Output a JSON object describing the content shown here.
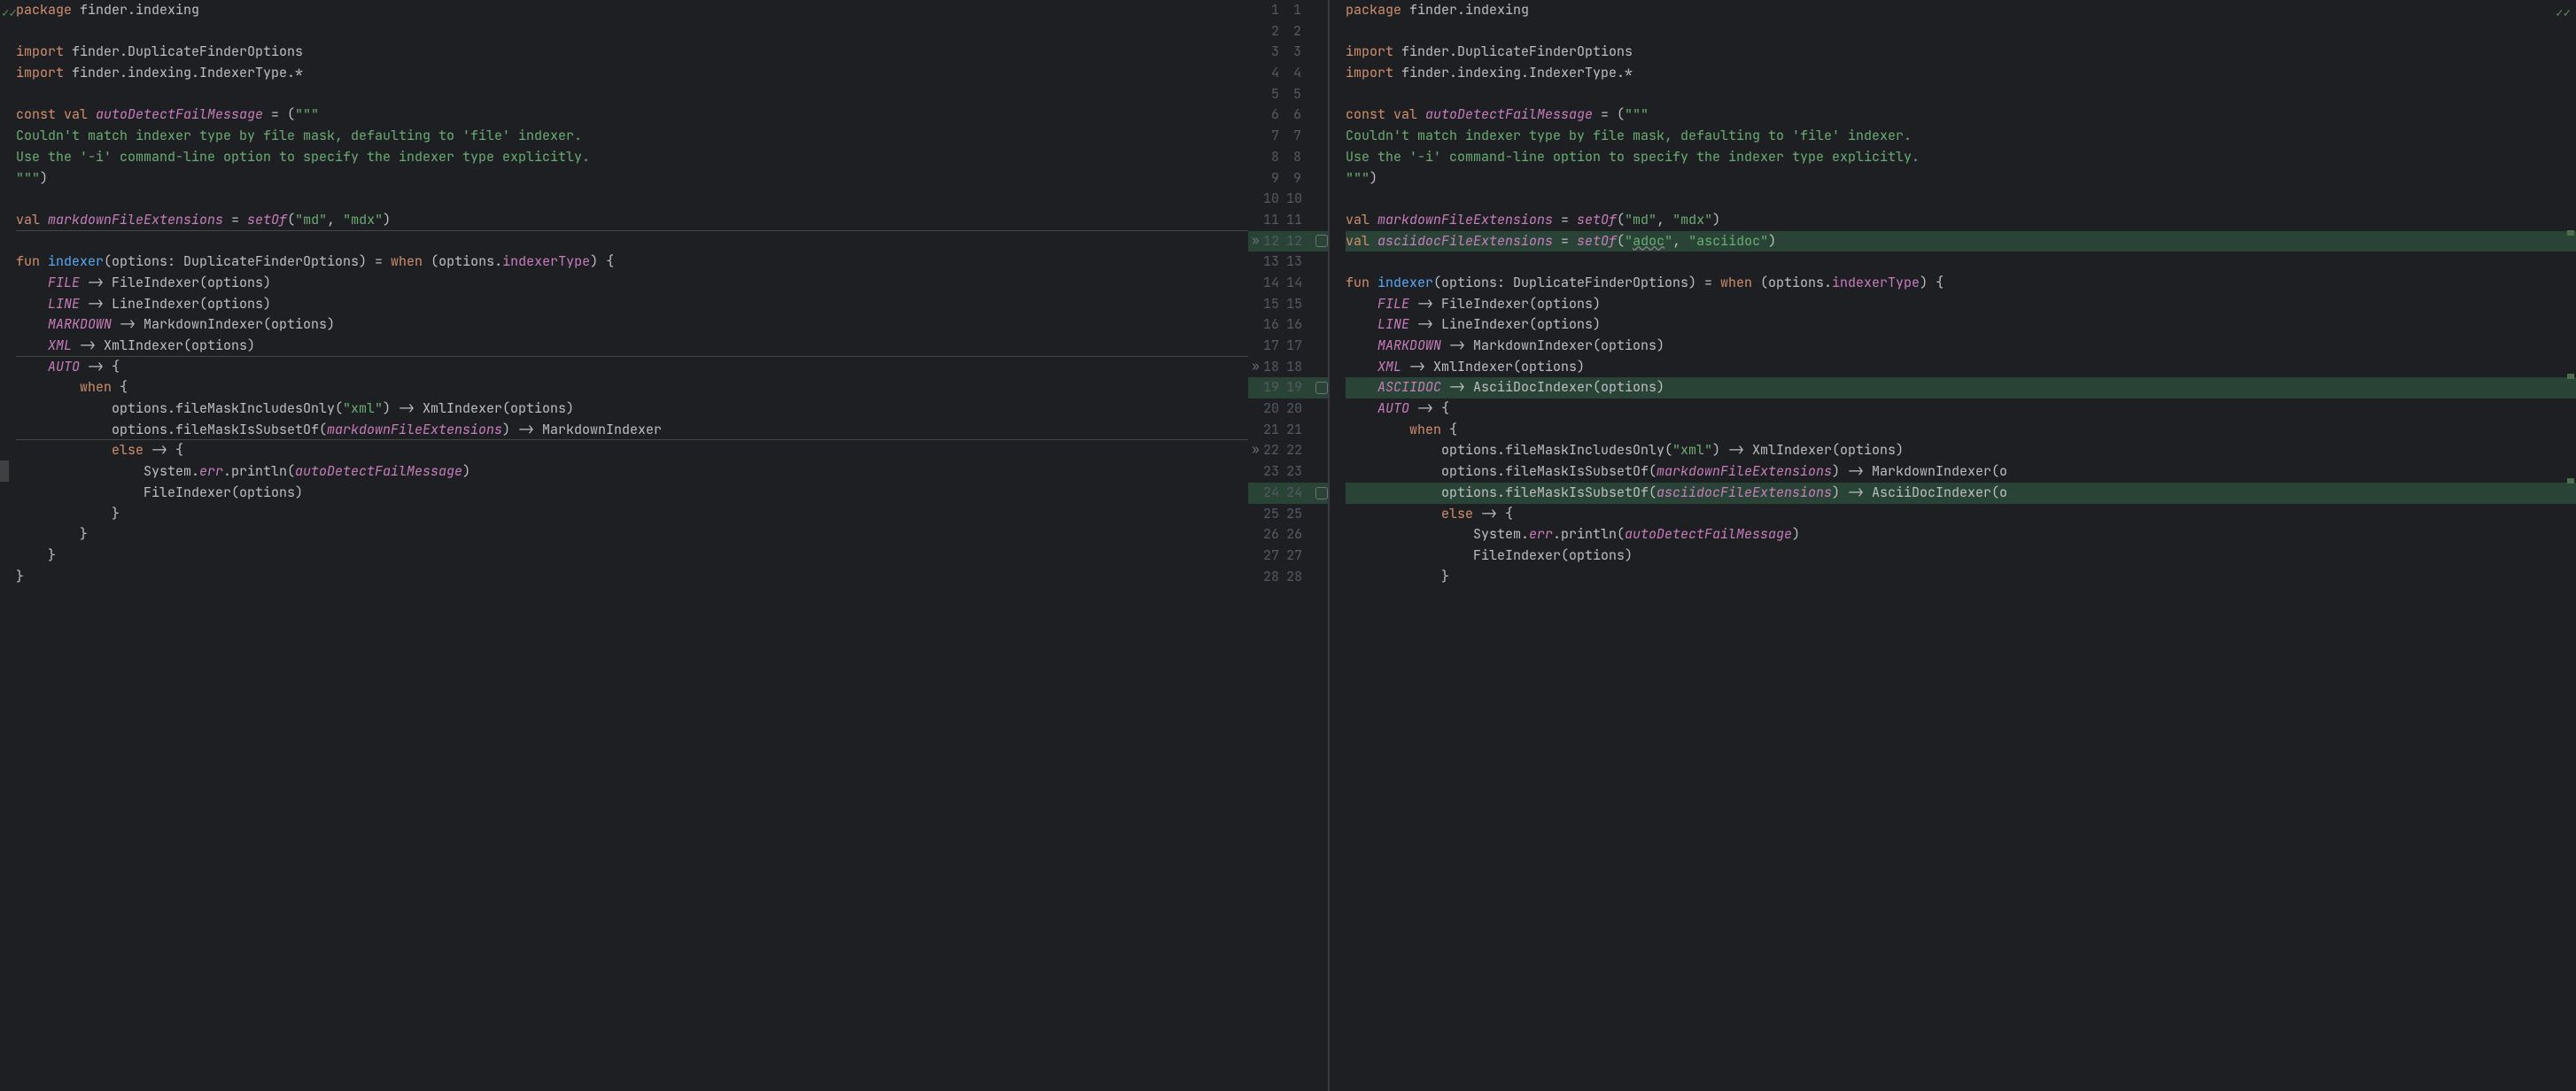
{
  "left": {
    "lines": [
      {
        "n": 1,
        "segs": [
          {
            "c": "kw",
            "t": "package "
          },
          {
            "c": "id",
            "t": "finder.indexing"
          }
        ]
      },
      {
        "n": 2,
        "segs": []
      },
      {
        "n": 3,
        "segs": [
          {
            "c": "kw",
            "t": "import "
          },
          {
            "c": "id",
            "t": "finder.DuplicateFinderOptions"
          }
        ]
      },
      {
        "n": 4,
        "segs": [
          {
            "c": "kw",
            "t": "import "
          },
          {
            "c": "id",
            "t": "finder.indexing.IndexerType.*"
          }
        ]
      },
      {
        "n": 5,
        "segs": []
      },
      {
        "n": 6,
        "segs": [
          {
            "c": "kw",
            "t": "const val "
          },
          {
            "c": "it",
            "t": "autoDetectFailMessage"
          },
          {
            "c": "id",
            "t": " = ("
          },
          {
            "c": "str",
            "t": "\"\"\""
          }
        ]
      },
      {
        "n": 7,
        "segs": [
          {
            "c": "str",
            "t": "Couldn't match indexer type by file mask, defaulting to 'file' indexer."
          }
        ]
      },
      {
        "n": 8,
        "segs": [
          {
            "c": "str",
            "t": "Use the '-i' command-line option to specify the indexer type explicitly."
          }
        ]
      },
      {
        "n": 9,
        "segs": [
          {
            "c": "str",
            "t": "\"\"\""
          },
          {
            "c": "id",
            "t": ")"
          }
        ]
      },
      {
        "n": 10,
        "segs": []
      },
      {
        "n": 11,
        "segs": [
          {
            "c": "kw",
            "t": "val "
          },
          {
            "c": "it",
            "t": "markdownFileExtensions"
          },
          {
            "c": "id",
            "t": " = "
          },
          {
            "c": "it",
            "t": "setOf"
          },
          {
            "c": "id",
            "t": "("
          },
          {
            "c": "str",
            "t": "\"md\""
          },
          {
            "c": "id",
            "t": ", "
          },
          {
            "c": "str",
            "t": "\"mdx\""
          },
          {
            "c": "id",
            "t": ")"
          }
        ],
        "edge": true
      },
      {
        "n": 12,
        "segs": []
      },
      {
        "n": 13,
        "segs": [
          {
            "c": "kw",
            "t": "fun "
          },
          {
            "c": "fn",
            "t": "indexer"
          },
          {
            "c": "id",
            "t": "(options: DuplicateFinderOptions) = "
          },
          {
            "c": "kw",
            "t": "when "
          },
          {
            "c": "id",
            "t": "(options."
          },
          {
            "c": "prop",
            "t": "indexerType"
          },
          {
            "c": "id",
            "t": ") {"
          }
        ]
      },
      {
        "n": 14,
        "segs": [
          {
            "c": "id",
            "t": "    "
          },
          {
            "c": "it",
            "t": "FILE"
          },
          {
            "c": "id",
            "t": " -> FileIndexer(options)"
          }
        ]
      },
      {
        "n": 15,
        "segs": [
          {
            "c": "id",
            "t": "    "
          },
          {
            "c": "it",
            "t": "LINE"
          },
          {
            "c": "id",
            "t": " -> LineIndexer(options)"
          }
        ]
      },
      {
        "n": 16,
        "segs": [
          {
            "c": "id",
            "t": "    "
          },
          {
            "c": "it",
            "t": "MARKDOWN"
          },
          {
            "c": "id",
            "t": " -> MarkdownIndexer(options)"
          }
        ]
      },
      {
        "n": 17,
        "segs": [
          {
            "c": "id",
            "t": "    "
          },
          {
            "c": "it",
            "t": "XML"
          },
          {
            "c": "id",
            "t": " -> XmlIndexer(options)"
          }
        ],
        "edge": true
      },
      {
        "n": 18,
        "segs": [
          {
            "c": "id",
            "t": "    "
          },
          {
            "c": "it",
            "t": "AUTO"
          },
          {
            "c": "id",
            "t": " -> {"
          }
        ]
      },
      {
        "n": 19,
        "segs": [
          {
            "c": "id",
            "t": "        "
          },
          {
            "c": "kw",
            "t": "when "
          },
          {
            "c": "id",
            "t": "{"
          }
        ]
      },
      {
        "n": 20,
        "segs": [
          {
            "c": "id",
            "t": "            options.fileMaskIncludesOnly("
          },
          {
            "c": "str",
            "t": "\"xml\""
          },
          {
            "c": "id",
            "t": ") -> XmlIndexer(options)"
          }
        ]
      },
      {
        "n": 21,
        "segs": [
          {
            "c": "id",
            "t": "            options.fileMaskIsSubsetOf("
          },
          {
            "c": "it",
            "t": "markdownFileExtensions"
          },
          {
            "c": "id",
            "t": ") -> MarkdownIndexer"
          }
        ],
        "edge": true
      },
      {
        "n": 22,
        "segs": [
          {
            "c": "id",
            "t": "            "
          },
          {
            "c": "kw",
            "t": "else "
          },
          {
            "c": "id",
            "t": "-> {"
          }
        ]
      },
      {
        "n": 23,
        "segs": [
          {
            "c": "id",
            "t": "                System."
          },
          {
            "c": "err",
            "t": "err"
          },
          {
            "c": "id",
            "t": ".println("
          },
          {
            "c": "it",
            "t": "autoDetectFailMessage"
          },
          {
            "c": "id",
            "t": ")"
          }
        ]
      },
      {
        "n": 24,
        "segs": [
          {
            "c": "id",
            "t": "                FileIndexer(options)"
          }
        ]
      },
      {
        "n": 25,
        "segs": [
          {
            "c": "id",
            "t": "            }"
          }
        ]
      },
      {
        "n": 26,
        "segs": [
          {
            "c": "id",
            "t": "        }"
          }
        ]
      },
      {
        "n": 27,
        "segs": [
          {
            "c": "id",
            "t": "    }"
          }
        ]
      },
      {
        "n": 28,
        "segs": [
          {
            "c": "id",
            "t": "}"
          }
        ]
      }
    ]
  },
  "right": {
    "lines": [
      {
        "n": 1,
        "segs": [
          {
            "c": "kw",
            "t": "package "
          },
          {
            "c": "id",
            "t": "finder.indexing"
          }
        ]
      },
      {
        "n": 2,
        "segs": []
      },
      {
        "n": 3,
        "segs": [
          {
            "c": "kw",
            "t": "import "
          },
          {
            "c": "id",
            "t": "finder.DuplicateFinderOptions"
          }
        ]
      },
      {
        "n": 4,
        "segs": [
          {
            "c": "kw",
            "t": "import "
          },
          {
            "c": "id",
            "t": "finder.indexing.IndexerType.*"
          }
        ]
      },
      {
        "n": 5,
        "segs": []
      },
      {
        "n": 6,
        "segs": [
          {
            "c": "kw",
            "t": "const val "
          },
          {
            "c": "it",
            "t": "autoDetectFailMessage"
          },
          {
            "c": "id",
            "t": " = ("
          },
          {
            "c": "str",
            "t": "\"\"\""
          }
        ]
      },
      {
        "n": 7,
        "segs": [
          {
            "c": "str",
            "t": "Couldn't match indexer type by file mask, defaulting to 'file' indexer."
          }
        ]
      },
      {
        "n": 8,
        "segs": [
          {
            "c": "str",
            "t": "Use the '-i' command-line option to specify the indexer type explicitly."
          }
        ]
      },
      {
        "n": 9,
        "segs": [
          {
            "c": "str",
            "t": "\"\"\""
          },
          {
            "c": "id",
            "t": ")"
          }
        ]
      },
      {
        "n": 10,
        "segs": []
      },
      {
        "n": 11,
        "segs": [
          {
            "c": "kw",
            "t": "val "
          },
          {
            "c": "it",
            "t": "markdownFileExtensions"
          },
          {
            "c": "id",
            "t": " = "
          },
          {
            "c": "it",
            "t": "setOf"
          },
          {
            "c": "id",
            "t": "("
          },
          {
            "c": "str",
            "t": "\"md\""
          },
          {
            "c": "id",
            "t": ", "
          },
          {
            "c": "str",
            "t": "\"mdx\""
          },
          {
            "c": "id",
            "t": ")"
          }
        ]
      },
      {
        "n": 12,
        "inserted": true,
        "segs": [
          {
            "c": "kw",
            "t": "val "
          },
          {
            "c": "it",
            "t": "asciidocFileExtensions"
          },
          {
            "c": "id",
            "t": " = "
          },
          {
            "c": "it",
            "t": "setOf"
          },
          {
            "c": "id",
            "t": "("
          },
          {
            "c": "str",
            "t": "\""
          },
          {
            "c": "str underline-wavy",
            "t": "adoc"
          },
          {
            "c": "str",
            "t": "\""
          },
          {
            "c": "id",
            "t": ", "
          },
          {
            "c": "str",
            "t": "\"asciidoc\""
          },
          {
            "c": "id",
            "t": ")"
          }
        ]
      },
      {
        "n": 13,
        "segs": []
      },
      {
        "n": 14,
        "segs": [
          {
            "c": "kw",
            "t": "fun "
          },
          {
            "c": "fn",
            "t": "indexer"
          },
          {
            "c": "id",
            "t": "(options: DuplicateFinderOptions) = "
          },
          {
            "c": "kw",
            "t": "when "
          },
          {
            "c": "id",
            "t": "(options."
          },
          {
            "c": "prop",
            "t": "indexerType"
          },
          {
            "c": "id",
            "t": ") {"
          }
        ]
      },
      {
        "n": 15,
        "segs": [
          {
            "c": "id",
            "t": "    "
          },
          {
            "c": "it",
            "t": "FILE"
          },
          {
            "c": "id",
            "t": " -> FileIndexer(options)"
          }
        ]
      },
      {
        "n": 16,
        "segs": [
          {
            "c": "id",
            "t": "    "
          },
          {
            "c": "it",
            "t": "LINE"
          },
          {
            "c": "id",
            "t": " -> LineIndexer(options)"
          }
        ]
      },
      {
        "n": 17,
        "segs": [
          {
            "c": "id",
            "t": "    "
          },
          {
            "c": "it",
            "t": "MARKDOWN"
          },
          {
            "c": "id",
            "t": " -> MarkdownIndexer(options)"
          }
        ]
      },
      {
        "n": 18,
        "segs": [
          {
            "c": "id",
            "t": "    "
          },
          {
            "c": "it",
            "t": "XML"
          },
          {
            "c": "id",
            "t": " -> XmlIndexer(options)"
          }
        ]
      },
      {
        "n": 19,
        "inserted": true,
        "segs": [
          {
            "c": "id",
            "t": "    "
          },
          {
            "c": "it",
            "t": "ASCIIDOC"
          },
          {
            "c": "id",
            "t": " -> AsciiDocIndexer(options)"
          }
        ]
      },
      {
        "n": 20,
        "segs": [
          {
            "c": "id",
            "t": "    "
          },
          {
            "c": "it",
            "t": "AUTO"
          },
          {
            "c": "id",
            "t": " -> {"
          }
        ]
      },
      {
        "n": 21,
        "segs": [
          {
            "c": "id",
            "t": "        "
          },
          {
            "c": "kw",
            "t": "when "
          },
          {
            "c": "id",
            "t": "{"
          }
        ]
      },
      {
        "n": 22,
        "segs": [
          {
            "c": "id",
            "t": "            options.fileMaskIncludesOnly("
          },
          {
            "c": "str",
            "t": "\"xml\""
          },
          {
            "c": "id",
            "t": ") -> XmlIndexer(options)"
          }
        ]
      },
      {
        "n": 23,
        "segs": [
          {
            "c": "id",
            "t": "            options.fileMaskIsSubsetOf("
          },
          {
            "c": "it",
            "t": "markdownFileExtensions"
          },
          {
            "c": "id",
            "t": ") -> MarkdownIndexer(o"
          }
        ]
      },
      {
        "n": 24,
        "inserted": true,
        "segs": [
          {
            "c": "id",
            "t": "            options.fileMaskIsSubsetOf("
          },
          {
            "c": "it",
            "t": "asciidocFileExtensions"
          },
          {
            "c": "id",
            "t": ") -> AsciiDocIndexer(o"
          }
        ]
      },
      {
        "n": 25,
        "segs": [
          {
            "c": "id",
            "t": "            "
          },
          {
            "c": "kw",
            "t": "else "
          },
          {
            "c": "id",
            "t": "-> {"
          }
        ]
      },
      {
        "n": 26,
        "segs": [
          {
            "c": "id",
            "t": "                System."
          },
          {
            "c": "err",
            "t": "err"
          },
          {
            "c": "id",
            "t": ".println("
          },
          {
            "c": "it",
            "t": "autoDetectFailMessage"
          },
          {
            "c": "id",
            "t": ")"
          }
        ]
      },
      {
        "n": 27,
        "segs": [
          {
            "c": "id",
            "t": "                FileIndexer(options)"
          }
        ]
      },
      {
        "n": 28,
        "segs": [
          {
            "c": "id",
            "t": "            }"
          }
        ]
      }
    ]
  },
  "middle": [
    {
      "l": 1,
      "r": 1
    },
    {
      "l": 2,
      "r": 2
    },
    {
      "l": 3,
      "r": 3
    },
    {
      "l": 4,
      "r": 4
    },
    {
      "l": 5,
      "r": 5
    },
    {
      "l": 6,
      "r": 6
    },
    {
      "l": 7,
      "r": 7
    },
    {
      "l": 8,
      "r": 8
    },
    {
      "l": 9,
      "r": 9
    },
    {
      "l": 10,
      "r": 10
    },
    {
      "l": 11,
      "r": 11
    },
    {
      "l": 12,
      "r": 12,
      "arrow": true,
      "chk": true,
      "insR": true
    },
    {
      "l": 13,
      "r": 13
    },
    {
      "l": 14,
      "r": 14
    },
    {
      "l": 15,
      "r": 15
    },
    {
      "l": 16,
      "r": 16
    },
    {
      "l": 17,
      "r": 17
    },
    {
      "l": 18,
      "r": 18,
      "arrow": true
    },
    {
      "l": 19,
      "r": 19,
      "chk": true,
      "insR": true
    },
    {
      "l": 20,
      "r": 20
    },
    {
      "l": 21,
      "r": 21
    },
    {
      "l": 22,
      "r": 22,
      "arrow": true
    },
    {
      "l": 23,
      "r": 23
    },
    {
      "l": 24,
      "r": 24,
      "chk": true,
      "insR": true
    },
    {
      "l": 25,
      "r": 25
    },
    {
      "l": 26,
      "r": 26
    },
    {
      "l": 27,
      "r": 27
    },
    {
      "l": 28,
      "r": 28
    }
  ],
  "icons": {
    "check": "✓✓",
    "arrow": "»"
  }
}
